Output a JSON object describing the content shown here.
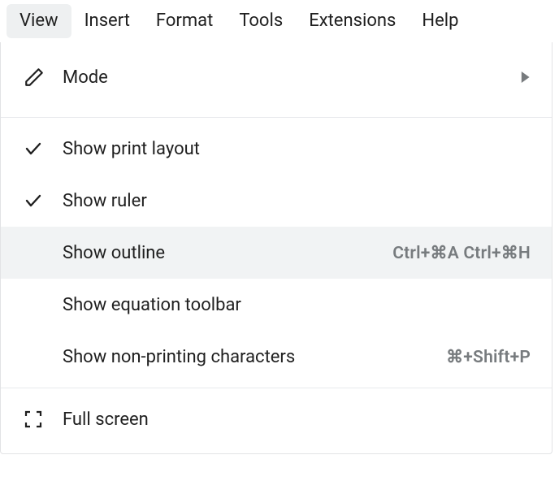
{
  "menubar": {
    "items": [
      {
        "label": "View",
        "active": true
      },
      {
        "label": "Insert",
        "active": false
      },
      {
        "label": "Format",
        "active": false
      },
      {
        "label": "Tools",
        "active": false
      },
      {
        "label": "Extensions",
        "active": false
      },
      {
        "label": "Help",
        "active": false
      }
    ]
  },
  "dropdown": {
    "mode": {
      "label": "Mode"
    },
    "showPrintLayout": {
      "label": "Show print layout",
      "checked": true
    },
    "showRuler": {
      "label": "Show ruler",
      "checked": true
    },
    "showOutline": {
      "label": "Show outline",
      "shortcut": "Ctrl+⌘A Ctrl+⌘H",
      "hover": true
    },
    "showEquationToolbar": {
      "label": "Show equation toolbar"
    },
    "showNonPrinting": {
      "label": "Show non-printing characters",
      "shortcut": "⌘+Shift+P"
    },
    "fullScreen": {
      "label": "Full screen"
    }
  }
}
